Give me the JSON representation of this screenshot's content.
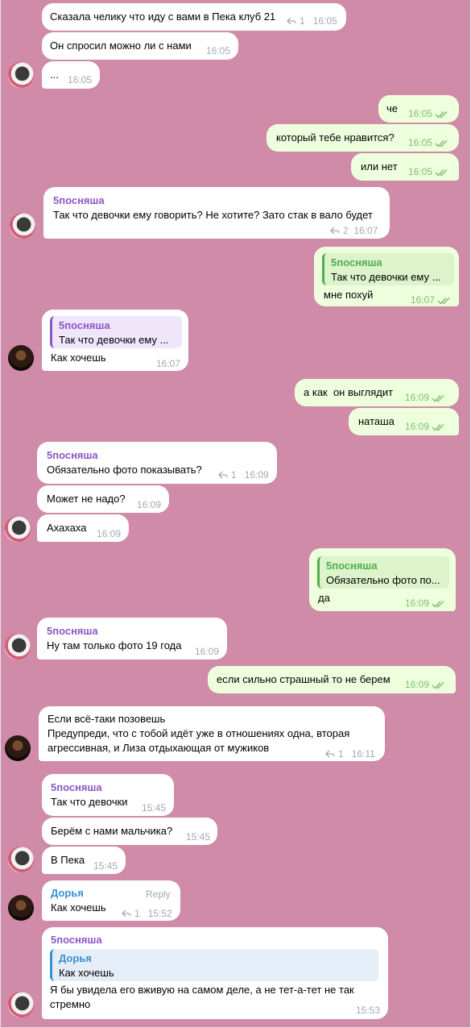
{
  "colors": {
    "background": "#cf8ba8",
    "incoming": "#ffffff",
    "outgoing": "#eeffde",
    "name_purple": "#8b57c6",
    "name_green": "#4fae4e",
    "name_blue": "#3a8fd1",
    "meta_gray": "#a3a9af",
    "meta_green": "#7fbf6f"
  },
  "messages": [
    {
      "text": "Сказала челику что иду с вами в Пека клуб 21",
      "replies": "1",
      "time": "16:05"
    },
    {
      "text": "Он спросил можно ли с нами",
      "time": "16:05"
    },
    {
      "text": "...",
      "time": "16:05"
    },
    {
      "text": "че",
      "time": "16:05"
    },
    {
      "text": "который тебе нравится?",
      "time": "16:05"
    },
    {
      "text": "или нет",
      "time": "16:05"
    },
    {
      "sender": "5посняша",
      "text": "Так что девочки ему говорить? Не хотите? Зато стак в вало будет",
      "replies": "2",
      "time": "16:07"
    },
    {
      "quote_name": "5посняша",
      "quote_text": "Так что девочки ему ...",
      "text": "мне похуй",
      "time": "16:07"
    },
    {
      "quote_name": "5посняша",
      "quote_text": "Так что девочки ему ...",
      "text": "Как хочешь",
      "time": "16:07"
    },
    {
      "text": "а как  он выглядит",
      "time": "16:09"
    },
    {
      "text": "наташа",
      "time": "16:09"
    },
    {
      "sender": "5посняша",
      "text": "Обязательно фото показывать?",
      "replies": "1",
      "time": "16:09"
    },
    {
      "text": "Может не надо?",
      "time": "16:09"
    },
    {
      "text": "Ахахаха",
      "time": "16:09"
    },
    {
      "quote_name": "5посняша",
      "quote_text": "Обязательно фото по...",
      "text": "да",
      "time": "16:09"
    },
    {
      "sender": "5посняша",
      "text": "Ну там только фото 19 года",
      "time": "16:09"
    },
    {
      "text": "если сильно страшный то не берем",
      "time": "16:09"
    },
    {
      "line1": "Если всё-таки позовешь",
      "line2": "Предупреди, что с тобой идёт уже в отношениях одна, вторая",
      "line3": "агрессивная, и Лиза отдыхающая от мужиков",
      "replies": "1",
      "time": "16:11"
    },
    {
      "sender": "5посняша",
      "text": "Так что девочки",
      "time": "15:45"
    },
    {
      "text": "Берём с нами мальчика?",
      "time": "15:45"
    },
    {
      "text": "В Пека",
      "time": "15:45"
    },
    {
      "sender": "Дорья",
      "reply_label": "Reply",
      "text": "Как хочешь",
      "replies": "1",
      "time": "15:52"
    },
    {
      "sender": "5посняша",
      "quote_name": "Дорья",
      "quote_text": "Как хочешь",
      "line1": "Я бы увидела его вживую на самом деле, а не тет-а-тет не так",
      "line2": "стремно",
      "time": "15:53"
    }
  ]
}
